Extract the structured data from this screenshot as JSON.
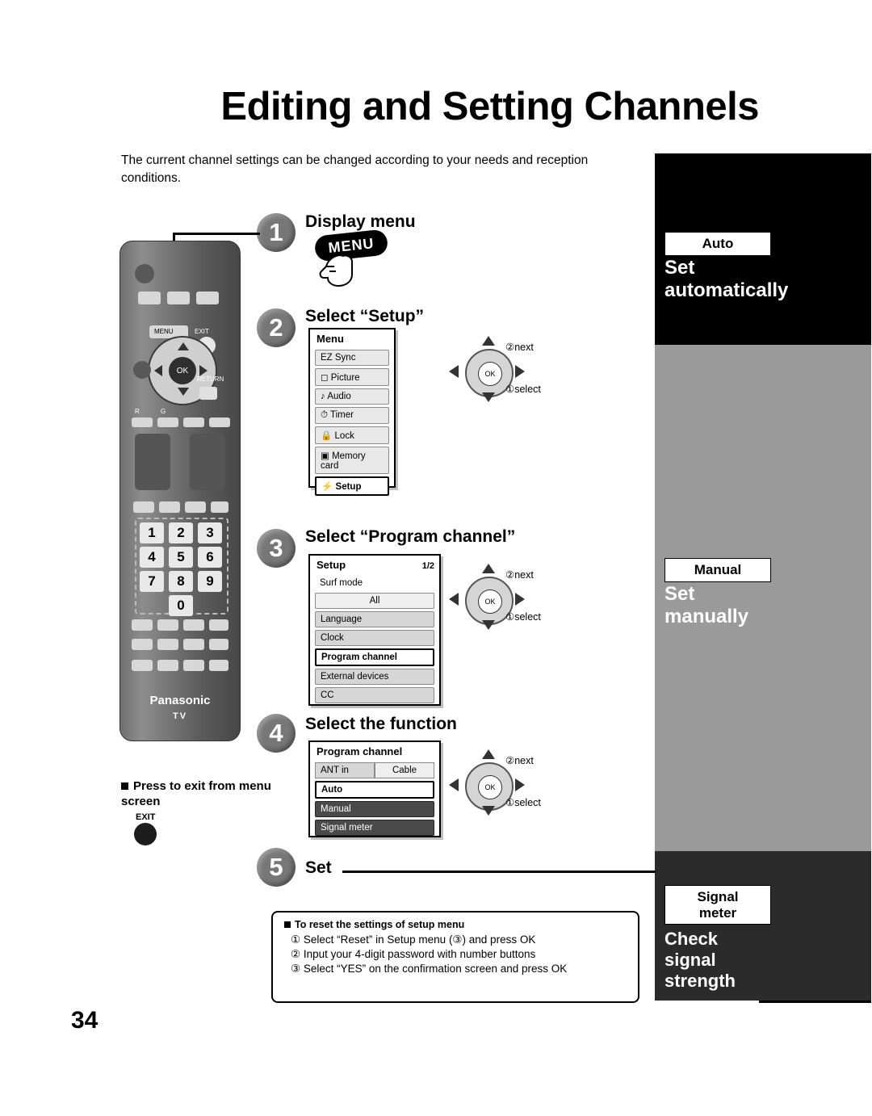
{
  "page": {
    "title": "Editing and Setting Channels",
    "intro": "The current channel settings can be changed according to your needs and reception conditions.",
    "number": "34"
  },
  "steps": [
    {
      "num": "1",
      "label": "Display menu"
    },
    {
      "num": "2",
      "label": "Select “Setup”"
    },
    {
      "num": "3",
      "label": "Select “Program channel”"
    },
    {
      "num": "4",
      "label": "Select the function"
    },
    {
      "num": "5",
      "label": "Set"
    }
  ],
  "menu_button": {
    "label": "MENU"
  },
  "remote": {
    "brand": "Panasonic",
    "sub_brand": "TV",
    "menu_label": "MENU",
    "exit_label": "EXIT",
    "return_label": "RETURN",
    "ok_label": "OK",
    "r_label": "R",
    "g_label": "G",
    "numbers": [
      "1",
      "2",
      "3",
      "4",
      "5",
      "6",
      "7",
      "8",
      "9",
      "0"
    ]
  },
  "osd_menu": {
    "title": "Menu",
    "items": [
      {
        "label": "EZ Sync",
        "icon": ""
      },
      {
        "label": "Picture",
        "icon": "□"
      },
      {
        "label": "Audio",
        "icon": "♪"
      },
      {
        "label": "Timer",
        "icon": "⏱"
      },
      {
        "label": "Lock",
        "icon": "⚿"
      },
      {
        "label": "Memory card",
        "icon": "▤"
      },
      {
        "label": "Setup",
        "icon": "⚡",
        "selected": true
      }
    ]
  },
  "osd_setup": {
    "title": "Setup",
    "page": "1/2",
    "items": [
      {
        "label": "Surf mode"
      },
      {
        "label": "All",
        "value": true
      },
      {
        "label": "Language"
      },
      {
        "label": "Clock"
      },
      {
        "label": "Program channel",
        "selected": true
      },
      {
        "label": "External devices"
      },
      {
        "label": "CC"
      }
    ]
  },
  "osd_program": {
    "title": "Program channel",
    "ant_in_label": "ANT in",
    "ant_in_value": "Cable",
    "items": [
      {
        "label": "Auto",
        "selected": true
      },
      {
        "label": "Manual"
      },
      {
        "label": "Signal meter"
      }
    ]
  },
  "nav_diagrams": [
    {
      "next": "next",
      "next_num": "②",
      "select": "select",
      "select_num": "①",
      "ok": "OK"
    },
    {
      "next": "next",
      "next_num": "②",
      "select": "select",
      "select_num": "①",
      "ok": "OK"
    },
    {
      "next": "next",
      "next_num": "②",
      "select": "select",
      "select_num": "①",
      "ok": "OK"
    }
  ],
  "side_tabs": [
    {
      "label": "Auto",
      "text_line1": "Set",
      "text_line2": "automatically"
    },
    {
      "label": "Manual",
      "text_line1": "Set",
      "text_line2": "manually"
    },
    {
      "label": "Signal meter",
      "text_line1": "Check",
      "text_line2": "signal",
      "text_line3": "strength"
    }
  ],
  "exit_note": {
    "text": "Press to exit from menu screen",
    "button_label": "EXIT"
  },
  "reset_note": {
    "heading": "To reset the settings of setup menu",
    "lines": [
      "① Select “Reset” in Setup menu (③) and press OK",
      "② Input your 4-digit password with number buttons",
      "③ Select “YES” on the confirmation screen and press OK"
    ]
  }
}
